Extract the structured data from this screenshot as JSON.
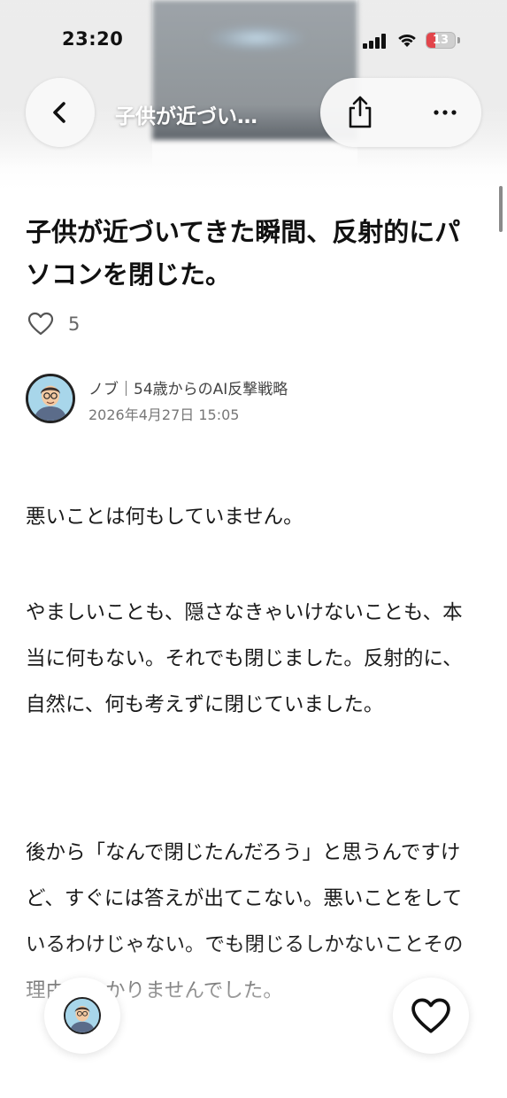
{
  "status_bar": {
    "time": "23:20",
    "battery_level": "13",
    "battery_color": "#e2454b",
    "icons": [
      "signal-icon",
      "wifi-icon",
      "battery-icon"
    ]
  },
  "header": {
    "title": "子供が近づい…",
    "back_icon": "chevron-left-icon",
    "share_icon": "share-icon",
    "more_icon": "more-horizontal-icon"
  },
  "article": {
    "title": "子供が近づいてきた瞬間、反射的にパソコンを閉じた。",
    "like_count": "5",
    "author": "ノブ｜54歳からのAI反撃戦略",
    "date": "2026年4月27日 15:05",
    "paragraphs": [
      "悪いことは何もしていません。",
      "やましいことも、隠さなきゃいけないことも、本当に何もない。それでも閉じました。反射的に、自然に、何も考えずに閉じていました。",
      "後から「なんで閉じたんだろう」と思うんですけど、すぐには答えが出てこない。悪いことをしているわけじゃない。でも閉じるしかないことその理由がわかりませんでした。"
    ]
  },
  "floating": {
    "like_icon": "heart-icon",
    "avatar_icon": "author-avatar"
  }
}
